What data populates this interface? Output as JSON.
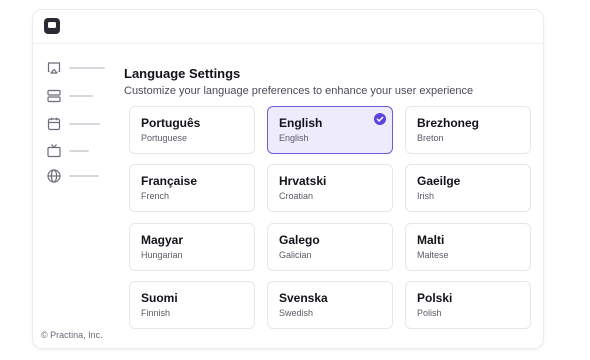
{
  "header": {
    "title": "Language Settings",
    "subtitle": "Customize your language preferences to enhance your user experience"
  },
  "sidebar": {
    "items": [
      {
        "icon": "airplay-icon"
      },
      {
        "icon": "server-icon"
      },
      {
        "icon": "calendar-icon"
      },
      {
        "icon": "tv-icon"
      },
      {
        "icon": "globe-icon"
      }
    ]
  },
  "footer": {
    "copyright": "© Practina, Inc."
  },
  "languages": [
    {
      "name": "Português",
      "english": "Portuguese",
      "selected": false
    },
    {
      "name": "English",
      "english": "English",
      "selected": true
    },
    {
      "name": "Brezhoneg",
      "english": "Breton",
      "selected": false
    },
    {
      "name": "Française",
      "english": "French",
      "selected": false
    },
    {
      "name": "Hrvatski",
      "english": "Croatian",
      "selected": false
    },
    {
      "name": "Gaeilge",
      "english": "Irish",
      "selected": false
    },
    {
      "name": "Magyar",
      "english": "Hungarian",
      "selected": false
    },
    {
      "name": "Galego",
      "english": "Galician",
      "selected": false
    },
    {
      "name": "Malti",
      "english": "Maltese",
      "selected": false
    },
    {
      "name": "Suomi",
      "english": "Finnish",
      "selected": false
    },
    {
      "name": "Svenska",
      "english": "Swedish",
      "selected": false
    },
    {
      "name": "Polski",
      "english": "Polish",
      "selected": false
    }
  ],
  "colors": {
    "accent": "#5b44d9",
    "selected_bg": "#eeebfd",
    "selected_border": "#6b5bd6"
  }
}
